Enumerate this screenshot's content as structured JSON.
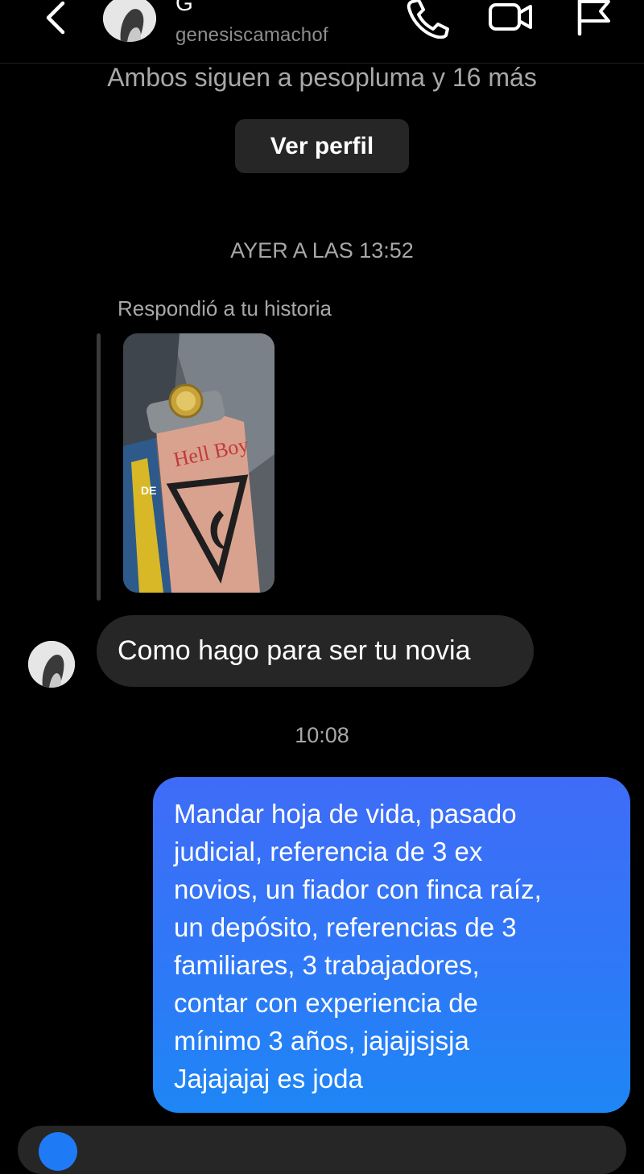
{
  "header": {
    "name_initial": "G",
    "username": "genesiscamachof",
    "icons": [
      "back-chevron-icon",
      "phone-icon",
      "video-camera-icon",
      "flag-icon"
    ]
  },
  "profile": {
    "mutual_followers": "Ambos siguen a pesopluma y 16 más",
    "view_profile_label": "Ver perfil"
  },
  "thread": {
    "timestamp_1": "AYER A LAS 13:52",
    "story_reply_label": "Respondió a tu historia",
    "story_text_tattoo": "Hell Boy",
    "story_text_side": "DE",
    "message_in": "Como hago para ser tu novia",
    "timestamp_2": "10:08",
    "message_out_lines": [
      "Mandar hoja de vida, pasado",
      "judicial, referencia de 3 ex",
      "novios, un fiador con finca raíz,",
      "un depósito, referencias de 3",
      "familiares, 3 trabajadores,",
      "contar con experiencia de",
      "mínimo 3 años, jajajjsjsja",
      "Jajajajaj es joda"
    ]
  },
  "colors": {
    "background": "#000000",
    "incoming_bubble": "#262626",
    "outgoing_bubble_top": "#3f6cf7",
    "outgoing_bubble_bottom": "#1e86f5",
    "secondary_text": "#a8a8a8"
  }
}
